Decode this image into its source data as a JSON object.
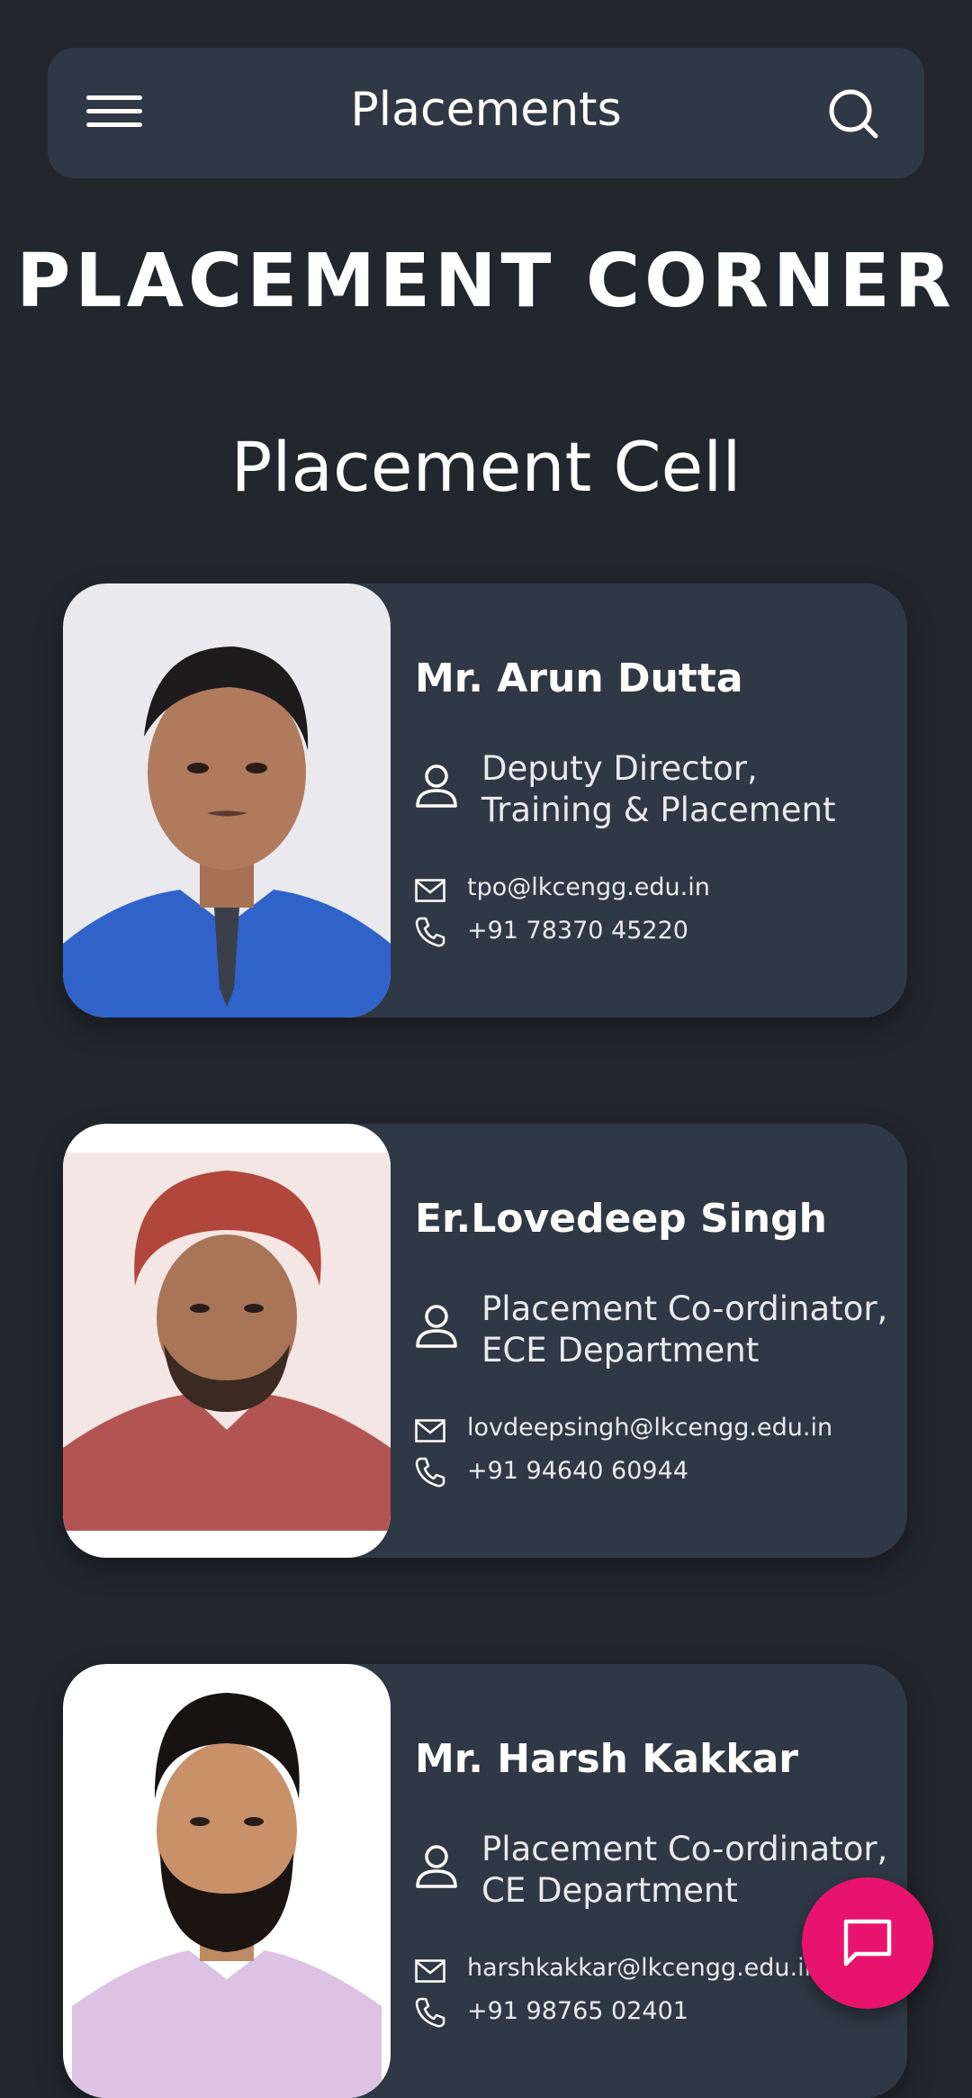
{
  "topbar": {
    "title": "Placements",
    "menu_icon": "menu-icon",
    "search_icon": "search-icon"
  },
  "heading": "PLACEMENT CORNER",
  "subheading": "Placement Cell",
  "contacts": [
    {
      "name": "Mr. Arun Dutta",
      "role_line1": "Deputy Director,",
      "role_line2": "Training & Placement",
      "email": "tpo@lkcengg.edu.in",
      "phone": "+91 78370 45220"
    },
    {
      "name": "Er.Lovedeep Singh",
      "role_line1": "Placement Co-ordinator,",
      "role_line2": "ECE Department",
      "email": "lovdeepsingh@lkcengg.edu.in",
      "phone": "+91 94640 60944"
    },
    {
      "name": "Mr. Harsh Kakkar",
      "role_line1": "Placement Co-ordinator,",
      "role_line2": "CE Department",
      "email": "harshkakkar@lkcengg.edu.in",
      "phone": "+91 98765 02401"
    }
  ],
  "fab": {
    "icon": "chat-icon"
  },
  "colors": {
    "background": "#22272e",
    "card": "#2f3945",
    "accent": "#e8136c"
  }
}
